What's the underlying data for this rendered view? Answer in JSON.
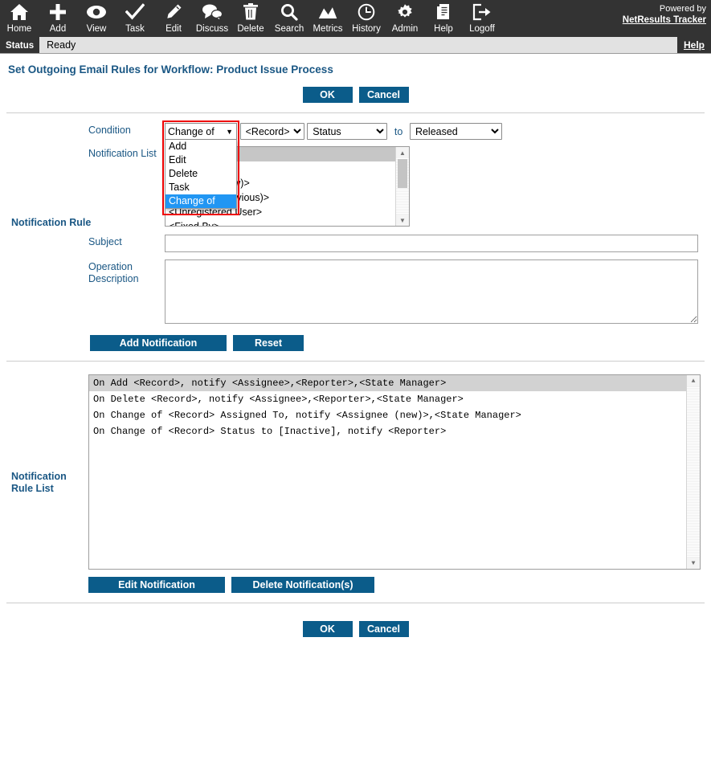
{
  "toolbar": {
    "items": [
      {
        "label": "Home",
        "icon": "home-icon"
      },
      {
        "label": "Add",
        "icon": "plus-icon"
      },
      {
        "label": "View",
        "icon": "eye-icon"
      },
      {
        "label": "Task",
        "icon": "check-icon"
      },
      {
        "label": "Edit",
        "icon": "pencil-icon"
      },
      {
        "label": "Discuss",
        "icon": "speech-bubbles-icon"
      },
      {
        "label": "Delete",
        "icon": "trash-icon"
      },
      {
        "label": "Search",
        "icon": "magnifier-icon"
      },
      {
        "label": "Metrics",
        "icon": "chart-icon"
      },
      {
        "label": "History",
        "icon": "clock-icon"
      },
      {
        "label": "Admin",
        "icon": "gear-icon"
      },
      {
        "label": "Help",
        "icon": "document-icon"
      },
      {
        "label": "Logoff",
        "icon": "exit-icon"
      }
    ],
    "branding_line1": "Powered by",
    "branding_line2": "NetResults Tracker"
  },
  "statusbar": {
    "tag": "Status",
    "text": "Ready",
    "help_label": "Help"
  },
  "page": {
    "title": "Set Outgoing Email Rules for Workflow: Product Issue Process",
    "ok_label": "OK",
    "cancel_label": "Cancel"
  },
  "notification_rule": {
    "group_label": "Notification Rule",
    "condition_label": "Condition",
    "notification_list_label": "Notification List",
    "subject_label": "Subject",
    "operation_description_label": "Operation Description",
    "to_word": "to",
    "condition_select": {
      "value": "Change of",
      "open": true,
      "options": [
        "Add",
        "Edit",
        "Delete",
        "Task",
        "Change of"
      ],
      "highlighted": "Change of"
    },
    "record_select": {
      "value": "<Record>",
      "options": [
        "<Record>"
      ]
    },
    "field_select": {
      "value": "Status",
      "options": [
        "Status"
      ]
    },
    "value_select": {
      "value": "Released",
      "options": [
        "Released"
      ]
    },
    "notification_list": {
      "items": [
        {
          "label": "",
          "selected": true
        },
        {
          "label": "",
          "selected": false
        },
        {
          "label": "<Assignee (new)>",
          "selected": false
        },
        {
          "label": "<Assignee (previous)>",
          "selected": false
        },
        {
          "label": "<Unregistered User>",
          "selected": false
        },
        {
          "label": "<Fixed By>",
          "selected": false
        }
      ]
    },
    "subject_value": "",
    "subject_placeholder": "",
    "operation_description_value": "",
    "operation_description_placeholder": "",
    "add_notification_label": "Add Notification",
    "reset_label": "Reset"
  },
  "notification_rule_list": {
    "label": "Notification Rule List",
    "items": [
      {
        "text": "On Add <Record>, notify <Assignee>,<Reporter>,<State Manager>",
        "selected": true
      },
      {
        "text": "On Delete <Record>, notify <Assignee>,<Reporter>,<State Manager>",
        "selected": false
      },
      {
        "text": "On Change of <Record> Assigned To, notify <Assignee (new)>,<State Manager>",
        "selected": false
      },
      {
        "text": "On Change of <Record> Status to [Inactive], notify <Reporter>",
        "selected": false
      }
    ],
    "edit_notification_label": "Edit Notification",
    "delete_notification_label": "Delete Notification(s)"
  },
  "colors": {
    "toolbar_bg": "#333333",
    "accent": "#0b5c8a",
    "link": "#1a5784",
    "highlight": "#2196f3",
    "redbox": "#ee0000"
  }
}
